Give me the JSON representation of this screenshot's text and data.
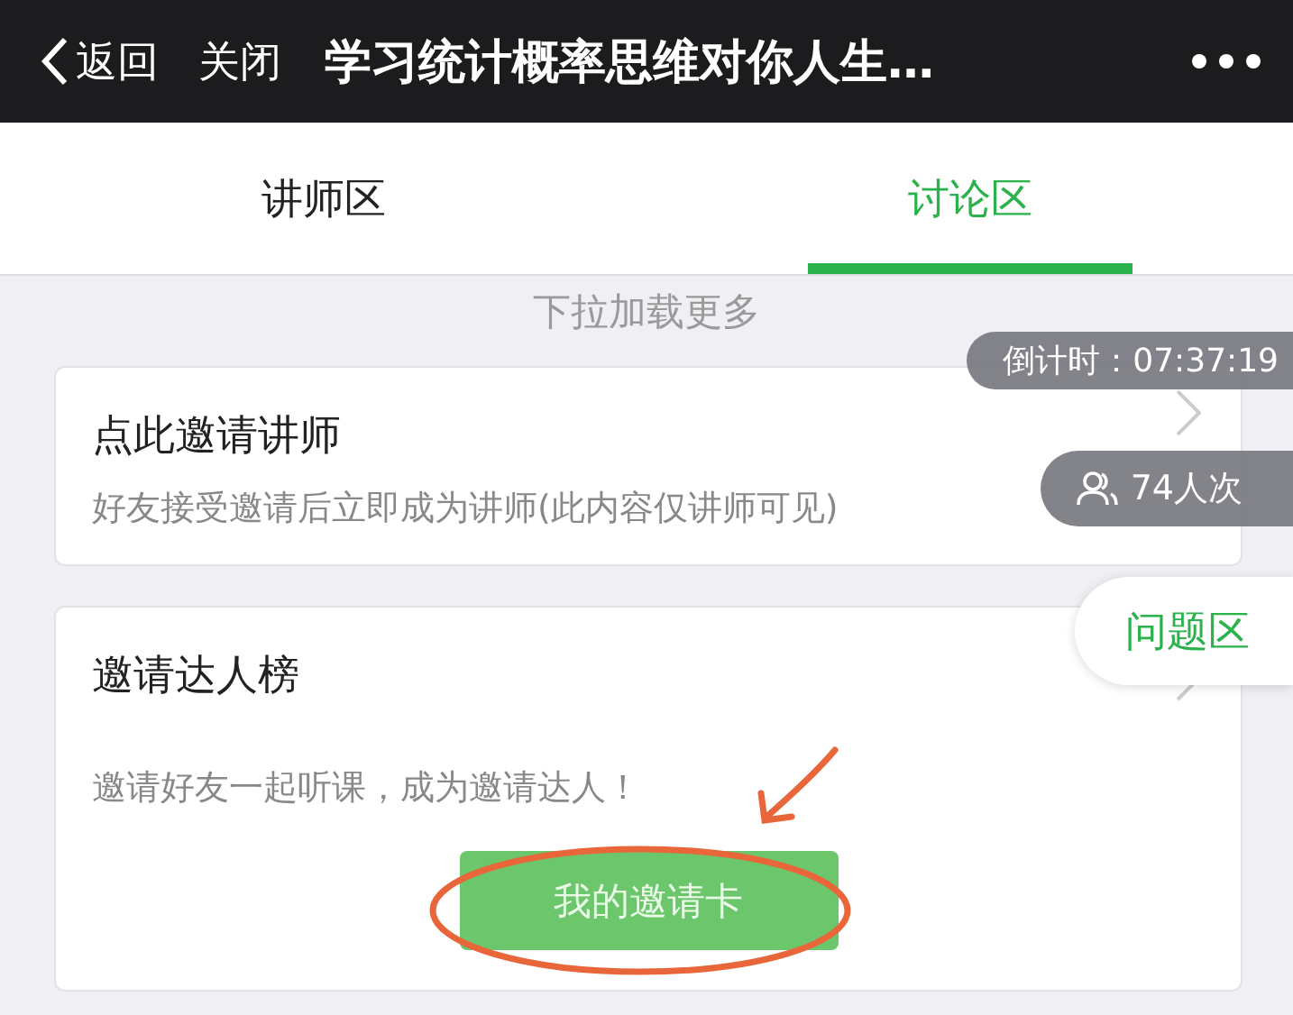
{
  "header": {
    "back_label": "返回",
    "close_label": "关闭",
    "title": "学习统计概率思维对你人生…"
  },
  "tabs": [
    {
      "label": "讲师区",
      "selected": false
    },
    {
      "label": "讨论区",
      "selected": true
    }
  ],
  "pull_hint": "下拉加载更多",
  "cards": [
    {
      "kind": "invite",
      "title": "点此邀请讲师",
      "subtitle": "好友接受邀请后立即成为讲师(此内容仅讲师可见)"
    },
    {
      "kind": "leaderboard",
      "title": "邀请达人榜",
      "description": "邀请好友一起听课，成为邀请达人！",
      "button": "我的邀请卡"
    }
  ],
  "countdown": "倒计时：07:37:19",
  "viewers": "74人次",
  "question_tab": "问题区"
}
